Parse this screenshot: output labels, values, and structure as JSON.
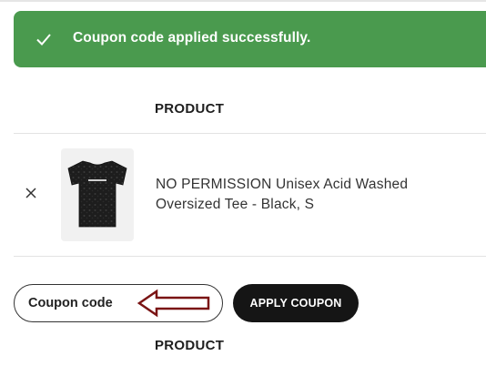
{
  "notice": {
    "message": "Coupon code applied successfully.",
    "color": "#4a9a4e",
    "icon": "check-icon"
  },
  "cart": {
    "column_header": "PRODUCT",
    "items": [
      {
        "name": "NO PERMISSION Unisex Acid Washed Oversized Tee - Black, S",
        "remove_icon": "close-icon",
        "thumbnail": "black-acid-washed-tee"
      }
    ]
  },
  "coupon": {
    "placeholder": "Coupon code",
    "value": "",
    "apply_label": "APPLY COUPON",
    "annotation": "arrow-pointing-left"
  },
  "footer_header": "PRODUCT"
}
